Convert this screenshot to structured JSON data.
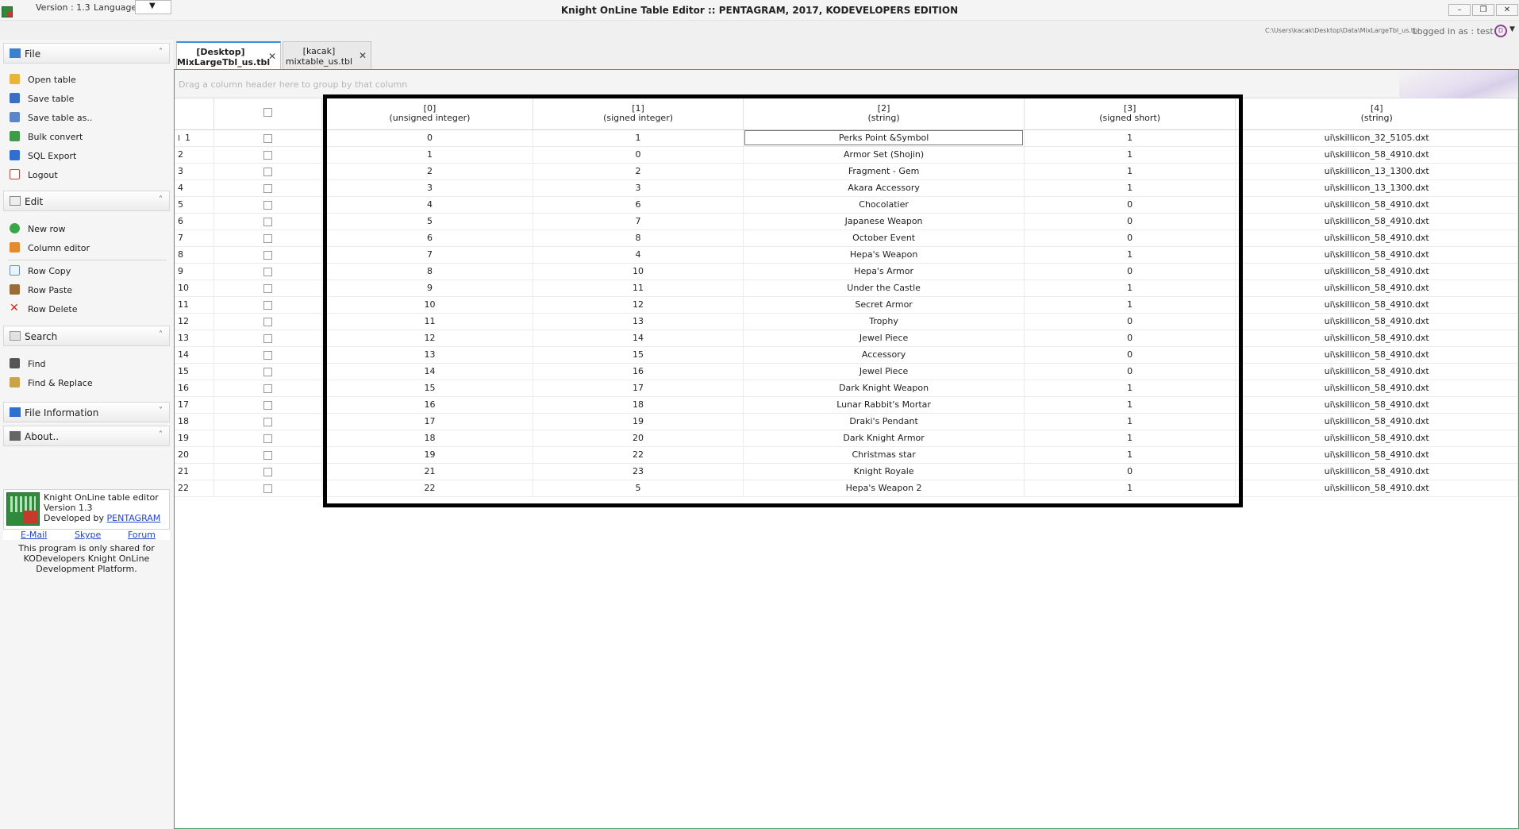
{
  "titlebar": {
    "version": "Version : 1.3",
    "language_label": "Language",
    "language_caret": "▼",
    "title": "Knight OnLine Table Editor :: PENTAGRAM, 2017, KODEVELOPERS EDITION",
    "minimize": "–",
    "restore": "❐",
    "close": "✕"
  },
  "status": {
    "path": "C:\\Users\\kacak\\Desktop\\Data\\MixLargeTbl_us.tbl",
    "logged_in": "Logged in as : test",
    "user_initial": "D",
    "user_caret": "▼"
  },
  "sidebar": {
    "file": {
      "header": "File",
      "items": [
        "Open table",
        "Save table",
        "Save table as..",
        "Bulk convert",
        "SQL Export",
        "Logout"
      ]
    },
    "edit": {
      "header": "Edit",
      "items": [
        "New row",
        "Column editor",
        "Row Copy",
        "Row Paste",
        "Row Delete"
      ]
    },
    "search": {
      "header": "Search",
      "items": [
        "Find",
        "Find & Replace"
      ]
    },
    "file_information": {
      "header": "File Information"
    },
    "about": {
      "header": "About..",
      "line1": "Knight OnLine table editor",
      "line2": "Version 1.3",
      "line3_prefix": "Developed by ",
      "line3_link": "PENTAGRAM",
      "links": [
        "E-Mail",
        "Skype",
        "Forum"
      ],
      "notice": "This program is only shared for KODevelopers Knight OnLine Development Platform."
    },
    "chevron_up": "˄",
    "chevron_down": "˅"
  },
  "tabs": [
    {
      "line1": "[Desktop]",
      "line2": "MixLargeTbl_us.tbl",
      "close": "✕"
    },
    {
      "line1": "[kacak]",
      "line2": "mixtable_us.tbl",
      "close": "✕"
    }
  ],
  "grid": {
    "group_hint": "Drag a column header here to group by that column",
    "columns": [
      {
        "index": "[0]",
        "type": "(unsigned integer)"
      },
      {
        "index": "[1]",
        "type": "(signed integer)"
      },
      {
        "index": "[2]",
        "type": "(string)"
      },
      {
        "index": "[3]",
        "type": "(signed short)"
      },
      {
        "index": "[4]",
        "type": "(string)"
      }
    ],
    "row_cursor": "I",
    "rows": [
      [
        "1",
        "0",
        "1",
        "Perks Point &Symbol",
        "1",
        "ui\\skillicon_32_5105.dxt"
      ],
      [
        "2",
        "1",
        "0",
        "Armor Set (Shojin)",
        "1",
        "ui\\skillicon_58_4910.dxt"
      ],
      [
        "3",
        "2",
        "2",
        "Fragment - Gem",
        "1",
        "ui\\skillicon_13_1300.dxt"
      ],
      [
        "4",
        "3",
        "3",
        "Akara Accessory",
        "1",
        "ui\\skillicon_13_1300.dxt"
      ],
      [
        "5",
        "4",
        "6",
        "Chocolatier",
        "0",
        "ui\\skillicon_58_4910.dxt"
      ],
      [
        "6",
        "5",
        "7",
        "Japanese Weapon",
        "0",
        "ui\\skillicon_58_4910.dxt"
      ],
      [
        "7",
        "6",
        "8",
        "October Event",
        "0",
        "ui\\skillicon_58_4910.dxt"
      ],
      [
        "8",
        "7",
        "4",
        "Hepa's Weapon",
        "1",
        "ui\\skillicon_58_4910.dxt"
      ],
      [
        "9",
        "8",
        "10",
        "Hepa's Armor",
        "0",
        "ui\\skillicon_58_4910.dxt"
      ],
      [
        "10",
        "9",
        "11",
        "Under the Castle",
        "1",
        "ui\\skillicon_58_4910.dxt"
      ],
      [
        "11",
        "10",
        "12",
        "Secret Armor",
        "1",
        "ui\\skillicon_58_4910.dxt"
      ],
      [
        "12",
        "11",
        "13",
        "Trophy",
        "0",
        "ui\\skillicon_58_4910.dxt"
      ],
      [
        "13",
        "12",
        "14",
        "Jewel Piece",
        "0",
        "ui\\skillicon_58_4910.dxt"
      ],
      [
        "14",
        "13",
        "15",
        "Accessory",
        "0",
        "ui\\skillicon_58_4910.dxt"
      ],
      [
        "15",
        "14",
        "16",
        "Jewel Piece",
        "0",
        "ui\\skillicon_58_4910.dxt"
      ],
      [
        "16",
        "15",
        "17",
        "Dark Knight Weapon",
        "1",
        "ui\\skillicon_58_4910.dxt"
      ],
      [
        "17",
        "16",
        "18",
        "Lunar Rabbit's Mortar",
        "1",
        "ui\\skillicon_58_4910.dxt"
      ],
      [
        "18",
        "17",
        "19",
        "Draki's Pendant",
        "1",
        "ui\\skillicon_58_4910.dxt"
      ],
      [
        "19",
        "18",
        "20",
        "Dark Knight Armor",
        "1",
        "ui\\skillicon_58_4910.dxt"
      ],
      [
        "20",
        "19",
        "22",
        "Christmas star",
        "1",
        "ui\\skillicon_58_4910.dxt"
      ],
      [
        "21",
        "21",
        "23",
        "Knight Royale",
        "0",
        "ui\\skillicon_58_4910.dxt"
      ],
      [
        "22",
        "22",
        "5",
        "Hepa's Weapon 2",
        "1",
        "ui\\skillicon_58_4910.dxt"
      ]
    ]
  },
  "colors": {
    "accent_green": "#49a05f",
    "active_tab_top": "#3b8ed8",
    "link_blue": "#2244cc"
  }
}
